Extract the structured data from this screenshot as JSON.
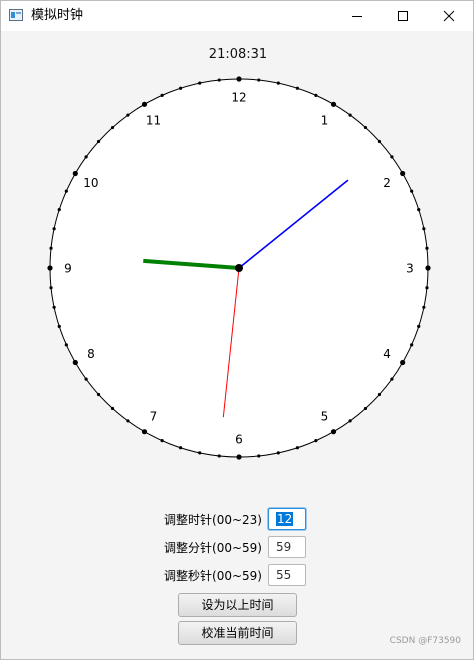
{
  "window": {
    "title": "模拟时钟"
  },
  "clock": {
    "digital_time": "21:08:31",
    "hour_numbers": [
      "12",
      "1",
      "2",
      "3",
      "4",
      "5",
      "6",
      "7",
      "8",
      "9",
      "10",
      "11"
    ],
    "hour_value": 21,
    "minute_value": 8,
    "second_value": 31,
    "colors": {
      "hour_hand": "#008000",
      "minute_hand": "#0000ff",
      "second_hand": "#ff0000"
    }
  },
  "controls": {
    "hour_label": "调整时针(00~23)",
    "hour_value": "12",
    "minute_label": "调整分针(00~59)",
    "minute_value": "59",
    "second_label": "调整秒针(00~59)",
    "second_value": "55",
    "set_button": "设为以上时间",
    "sync_button": "校准当前时间"
  },
  "watermark": "CSDN @F73590"
}
